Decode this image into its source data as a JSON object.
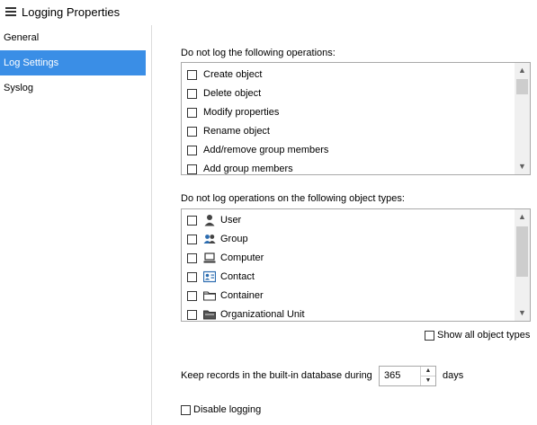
{
  "window": {
    "title": "Logging Properties"
  },
  "sidebar": {
    "items": [
      {
        "label": "General",
        "active": false
      },
      {
        "label": "Log Settings",
        "active": true
      },
      {
        "label": "Syslog",
        "active": false
      }
    ]
  },
  "operations": {
    "label": "Do not log the following operations:",
    "items": [
      {
        "label": "Create object",
        "checked": false
      },
      {
        "label": "Delete object",
        "checked": false
      },
      {
        "label": "Modify properties",
        "checked": false
      },
      {
        "label": "Rename object",
        "checked": false
      },
      {
        "label": "Add/remove group members",
        "checked": false
      },
      {
        "label": "Add group members",
        "checked": false
      }
    ]
  },
  "object_types": {
    "label": "Do not log operations on the following object types:",
    "items": [
      {
        "label": "User",
        "icon": "user-icon",
        "checked": false
      },
      {
        "label": "Group",
        "icon": "group-icon",
        "checked": false
      },
      {
        "label": "Computer",
        "icon": "computer-icon",
        "checked": false
      },
      {
        "label": "Contact",
        "icon": "contact-icon",
        "checked": false
      },
      {
        "label": "Container",
        "icon": "folder-icon",
        "checked": false
      },
      {
        "label": "Organizational Unit",
        "icon": "organizational-unit-icon",
        "checked": false
      }
    ]
  },
  "show_all_label": "Show all object types",
  "keep_records": {
    "label": "Keep records in the built-in database during",
    "value": "365",
    "unit": "days"
  },
  "disable_logging_label": "Disable logging"
}
